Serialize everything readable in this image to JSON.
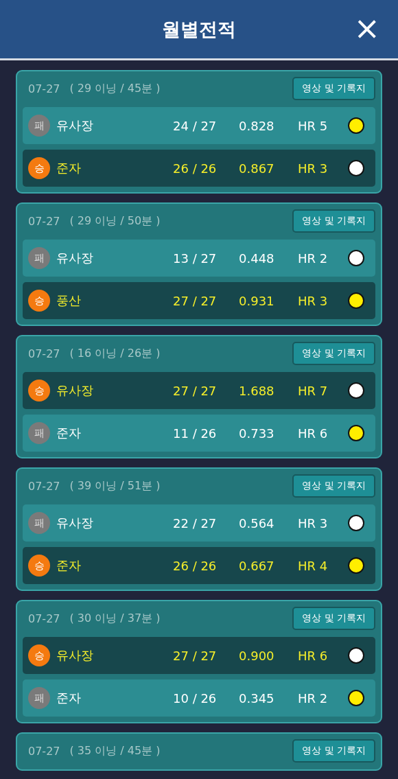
{
  "header": {
    "title": "월별전적",
    "close": "×"
  },
  "games": [
    {
      "date": "07-27",
      "info": "( 29 이닝 / 45분 )",
      "button": "영상 및 기록지",
      "players": [
        {
          "result": "패",
          "won": false,
          "name": "유사장",
          "score": "24 / 27",
          "avg": "0.828",
          "hr": "HR 5",
          "color": "#ffee00"
        },
        {
          "result": "승",
          "won": true,
          "name": "준자",
          "score": "26 / 26",
          "avg": "0.867",
          "hr": "HR 3",
          "color": "#ffffff"
        }
      ]
    },
    {
      "date": "07-27",
      "info": "( 29 이닝 / 50분 )",
      "button": "영상 및 기록지",
      "players": [
        {
          "result": "패",
          "won": false,
          "name": "유사장",
          "score": "13 / 27",
          "avg": "0.448",
          "hr": "HR 2",
          "color": "#ffffff"
        },
        {
          "result": "승",
          "won": true,
          "name": "풍산",
          "score": "27 / 27",
          "avg": "0.931",
          "hr": "HR 3",
          "color": "#ffee00"
        }
      ]
    },
    {
      "date": "07-27",
      "info": "( 16 이닝 / 26분 )",
      "button": "영상 및 기록지",
      "players": [
        {
          "result": "승",
          "won": true,
          "name": "유사장",
          "score": "27 / 27",
          "avg": "1.688",
          "hr": "HR 7",
          "color": "#ffffff"
        },
        {
          "result": "패",
          "won": false,
          "name": "준자",
          "score": "11 / 26",
          "avg": "0.733",
          "hr": "HR 6",
          "color": "#ffee00"
        }
      ]
    },
    {
      "date": "07-27",
      "info": "( 39 이닝 / 51분 )",
      "button": "영상 및 기록지",
      "players": [
        {
          "result": "패",
          "won": false,
          "name": "유사장",
          "score": "22 / 27",
          "avg": "0.564",
          "hr": "HR 3",
          "color": "#ffffff"
        },
        {
          "result": "승",
          "won": true,
          "name": "준자",
          "score": "26 / 26",
          "avg": "0.667",
          "hr": "HR 4",
          "color": "#ffee00"
        }
      ]
    },
    {
      "date": "07-27",
      "info": "( 30 이닝 / 37분 )",
      "button": "영상 및 기록지",
      "players": [
        {
          "result": "승",
          "won": true,
          "name": "유사장",
          "score": "27 / 27",
          "avg": "0.900",
          "hr": "HR 6",
          "color": "#ffffff"
        },
        {
          "result": "패",
          "won": false,
          "name": "준자",
          "score": "10 / 26",
          "avg": "0.345",
          "hr": "HR 2",
          "color": "#ffee00"
        }
      ]
    },
    {
      "date": "07-27",
      "info": "( 35 이닝 / 45분 )",
      "button": "영상 및 기록지"
    }
  ]
}
